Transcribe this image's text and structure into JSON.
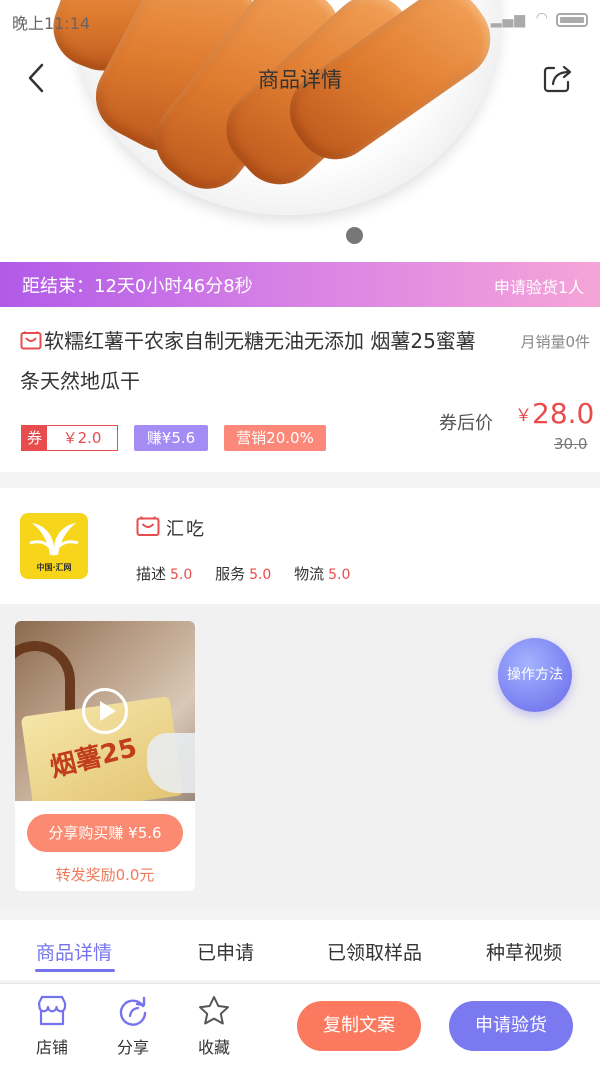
{
  "status_bar": {
    "time": "晚上11:14"
  },
  "nav": {
    "title": "商品详情"
  },
  "countdown": {
    "text": "距结束：12天0小时46分8秒",
    "applied": "申请验货1人"
  },
  "product": {
    "title": "软糯红薯干农家自制无糖无油无添加 烟薯25蜜薯条天然地瓜干",
    "sales": "月销量0件",
    "coupon_tag": "券",
    "coupon_value": "￥2.0",
    "earn_tag": "赚¥5.6",
    "marketing_tag": "营销20.0%",
    "price_label": "券后价",
    "price_symbol": "￥",
    "price": "28.0",
    "original_price": "30.0"
  },
  "shop": {
    "name": "汇吃",
    "logo_text": "中国·汇网",
    "ratings": [
      {
        "label": "描述",
        "score": "5.0"
      },
      {
        "label": "服务",
        "score": "5.0"
      },
      {
        "label": "物流",
        "score": "5.0"
      }
    ]
  },
  "video": {
    "share_button": "分享购买赚 ¥5.6",
    "reward": "转发奖励0.0元",
    "thumb_text": "烟薯25"
  },
  "float_button": "操作方法",
  "tabs": [
    {
      "label": "商品详情",
      "active": true
    },
    {
      "label": "已申请",
      "active": false
    },
    {
      "label": "已领取样品",
      "active": false
    },
    {
      "label": "种草视频",
      "active": false
    }
  ],
  "bottom_bar": {
    "store": "店铺",
    "share": "分享",
    "favorite": "收藏",
    "copy_button": "复制文案",
    "apply_button": "申请验货"
  },
  "colors": {
    "accent": "#7574ee",
    "price": "#e84c4c",
    "orange": "#fb7a5f"
  }
}
